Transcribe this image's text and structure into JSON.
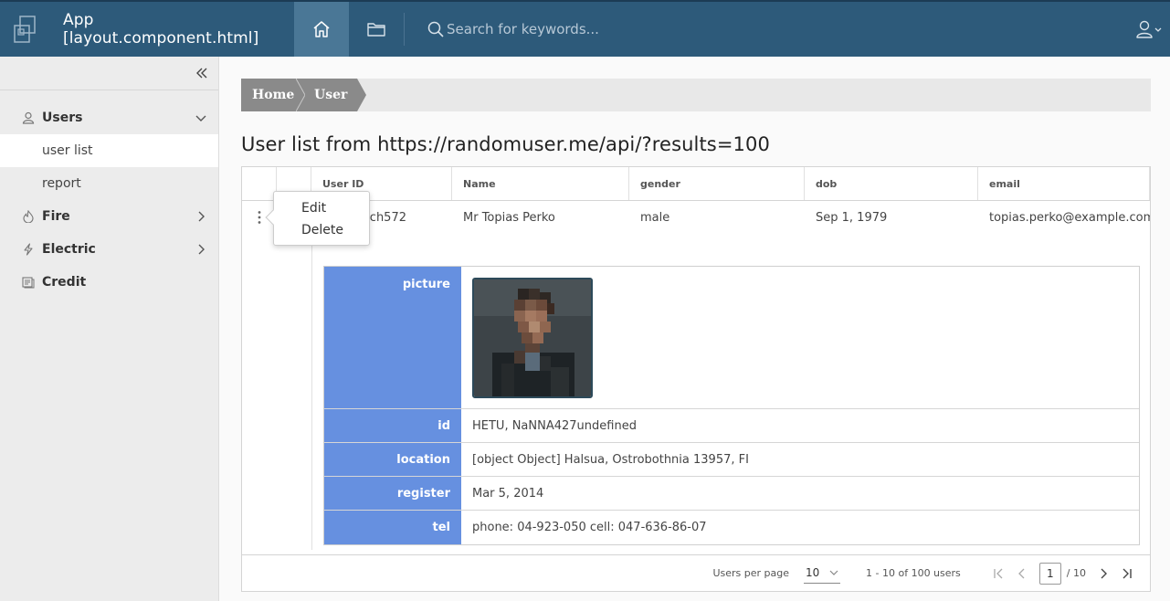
{
  "header": {
    "app_title": "App [layout.component.html]",
    "search_placeholder": "Search for keywords..."
  },
  "sidebar": {
    "groups": [
      {
        "label": "Users",
        "icon": "user-icon",
        "expanded": true,
        "items": [
          "user list",
          "report"
        ]
      },
      {
        "label": "Fire",
        "icon": "fire-icon"
      },
      {
        "label": "Electric",
        "icon": "bolt-icon"
      },
      {
        "label": "Credit",
        "icon": "credit-icon"
      }
    ],
    "active_item": "user list"
  },
  "breadcrumb": [
    "Home",
    "User"
  ],
  "page_title": "User list from https://randomuser.me/api/?results=100",
  "grid": {
    "columns": [
      "User ID",
      "Name",
      "gender",
      "dob",
      "email"
    ],
    "rows": [
      {
        "user_id": "ch572",
        "name": "Mr Topias Perko",
        "gender": "male",
        "dob": "Sep 1, 1979",
        "email": "topias.perko@example.com"
      }
    ],
    "detail": {
      "labels": {
        "picture": "picture",
        "id": "id",
        "location": "location",
        "register": "register",
        "tel": "tel"
      },
      "values": {
        "id": "HETU, NaNNA427undefined",
        "location": "[object Object] Halsua, Ostrobothnia 13957, FI",
        "register": "Mar 5, 2014",
        "tel": "phone: 04-923-050 cell: 047-636-86-07"
      }
    }
  },
  "pager": {
    "per_page_label": "Users per page",
    "per_page_value": "10",
    "range_text": "1 - 10 of 100 users",
    "current_page": "1",
    "total_pages": "/ 10"
  },
  "context_menu": {
    "items": [
      "Edit",
      "Delete"
    ]
  },
  "colors": {
    "header_bg": "#2d5a7a",
    "header_active": "#4a7796",
    "detail_key_bg": "#6690e0",
    "breadcrumb_bg": "#8a8a8a"
  }
}
